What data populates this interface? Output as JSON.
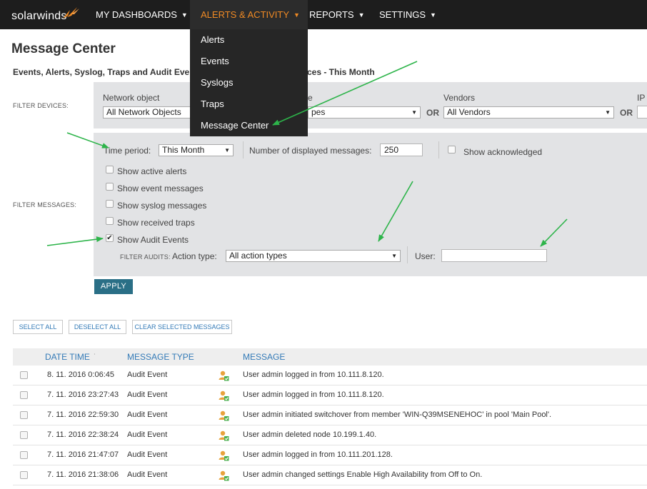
{
  "brand": {
    "logo_text": "solarwinds"
  },
  "nav": {
    "dashboards": "MY DASHBOARDS",
    "alerts": "ALERTS & ACTIVITY",
    "reports": "REPORTS",
    "settings": "SETTINGS"
  },
  "dropdown": [
    "Alerts",
    "Events",
    "Syslogs",
    "Traps",
    "Message Center"
  ],
  "page": {
    "title": "Message Center",
    "subtitle_left": "Events, Alerts, Syslog, Traps and Audit Eve",
    "subtitle_right": "ces - This Month"
  },
  "filter_devices": {
    "label": "FILTER DEVICES:",
    "network_object_label": "Network object",
    "network_object_value": "All Network Objects",
    "type_label_tail": "e",
    "type_value_tail": "pes",
    "or": "OR",
    "vendors_label": "Vendors",
    "vendors_value": "All Vendors",
    "ip_label": "IP"
  },
  "filter_messages": {
    "label": "FILTER MESSAGES:",
    "time_period_label": "Time period:",
    "time_period_value": "This Month",
    "num_messages_label": "Number of displayed messages:",
    "num_messages_value": "250",
    "show_acknowledged": "Show acknowledged",
    "checkboxes": [
      {
        "label": "Show active alerts",
        "checked": false
      },
      {
        "label": "Show event messages",
        "checked": false
      },
      {
        "label": "Show syslog messages",
        "checked": false
      },
      {
        "label": "Show received traps",
        "checked": false
      },
      {
        "label": "Show Audit Events",
        "checked": true
      }
    ],
    "audits_label": "FILTER AUDITS:",
    "action_type_label": "Action type:",
    "action_type_value": "All action types",
    "user_label": "User:",
    "user_value": ""
  },
  "buttons": {
    "apply": "APPLY",
    "select_all": "SELECT ALL",
    "deselect_all": "DESELECT ALL",
    "clear_selected": "CLEAR SELECTED MESSAGES"
  },
  "table": {
    "headers": {
      "date_time": "DATE TIME",
      "sort_icon": "˙",
      "message_type": "MESSAGE TYPE",
      "message": "MESSAGE"
    },
    "rows": [
      {
        "date": "8. 11. 2016 0:06:45",
        "type": "Audit Event",
        "message": "User admin logged in from 10.111.8.120."
      },
      {
        "date": "7. 11. 2016 23:27:43",
        "type": "Audit Event",
        "message": "User admin logged in from 10.111.8.120."
      },
      {
        "date": "7. 11. 2016 22:59:30",
        "type": "Audit Event",
        "message": "User admin initiated switchover from member 'WIN-Q39MSENEHOC' in pool 'Main Pool'."
      },
      {
        "date": "7. 11. 2016 22:38:24",
        "type": "Audit Event",
        "message": "User admin deleted node 10.199.1.40."
      },
      {
        "date": "7. 11. 2016 21:47:07",
        "type": "Audit Event",
        "message": "User admin logged in from 10.111.201.128."
      },
      {
        "date": "7. 11. 2016 21:38:06",
        "type": "Audit Event",
        "message": "User admin changed settings Enable High Availability from Off to On."
      }
    ]
  },
  "colors": {
    "nav_bg": "#1d1d1d",
    "accent_orange": "#f08a24",
    "link_blue": "#337ab7",
    "apply_bg": "#2a6f86",
    "panel_bg": "#e2e3e5",
    "annotation_green": "#2db44a"
  },
  "icons": {
    "logo_mark": "logo-swoosh-icon",
    "caret": "caret-down-icon",
    "select_arrow": "select-arrow-icon",
    "audit_event": "audit-user-icon",
    "annotation": "green-arrow-icon"
  }
}
